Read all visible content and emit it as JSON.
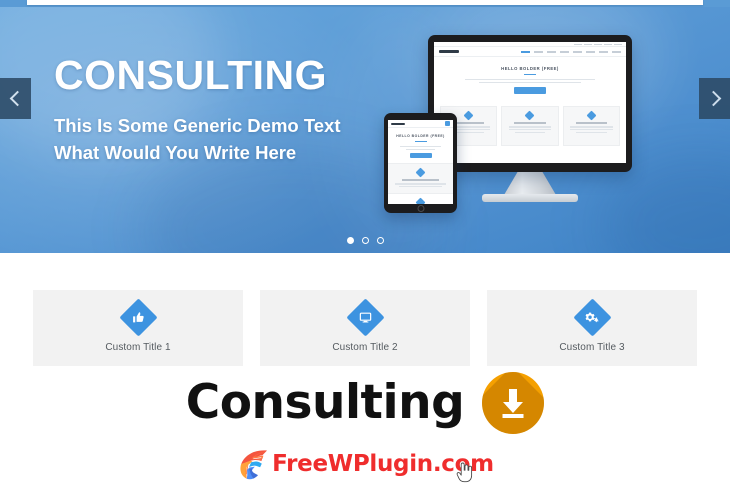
{
  "hero": {
    "title": "CONSULTING",
    "subtitle_line1": "This Is Some Generic Demo Text",
    "subtitle_line2": "What Would You Write Here",
    "prev_arrow_label": "‹",
    "next_arrow_label": "›",
    "background_color": "#5b9bd6",
    "arrow_color": "#2c4a66",
    "dots": [
      {
        "label": "slide-1",
        "active": true
      },
      {
        "label": "slide-2",
        "active": false
      },
      {
        "label": "slide-3",
        "active": false
      }
    ],
    "mockup": {
      "brand": "Bolder Theme",
      "headline": "HELLO BOLDER (FREE)",
      "button_label": "DOWNLOAD",
      "accent_color": "#4a9be0"
    }
  },
  "features": {
    "cards": [
      {
        "title": "Custom Title 1",
        "icon": "thumbs-up-icon"
      },
      {
        "title": "Custom Title 2",
        "icon": "desktop-monitor-icon"
      },
      {
        "title": "Custom Title 3",
        "icon": "cogs-icon"
      }
    ],
    "card_background": "#f2f2f2",
    "icon_color": "#3d93e0"
  },
  "brand": {
    "product_name": "Consulting",
    "download_icon": "download-icon",
    "download_icon_color": "#f5a000"
  },
  "footer": {
    "site_name": "FreeWPlugin.com",
    "site_name_color": "#ef2d2d",
    "logo_icon": "freewplugin-logo-icon",
    "cursor_icon": "hand-cursor-icon"
  }
}
